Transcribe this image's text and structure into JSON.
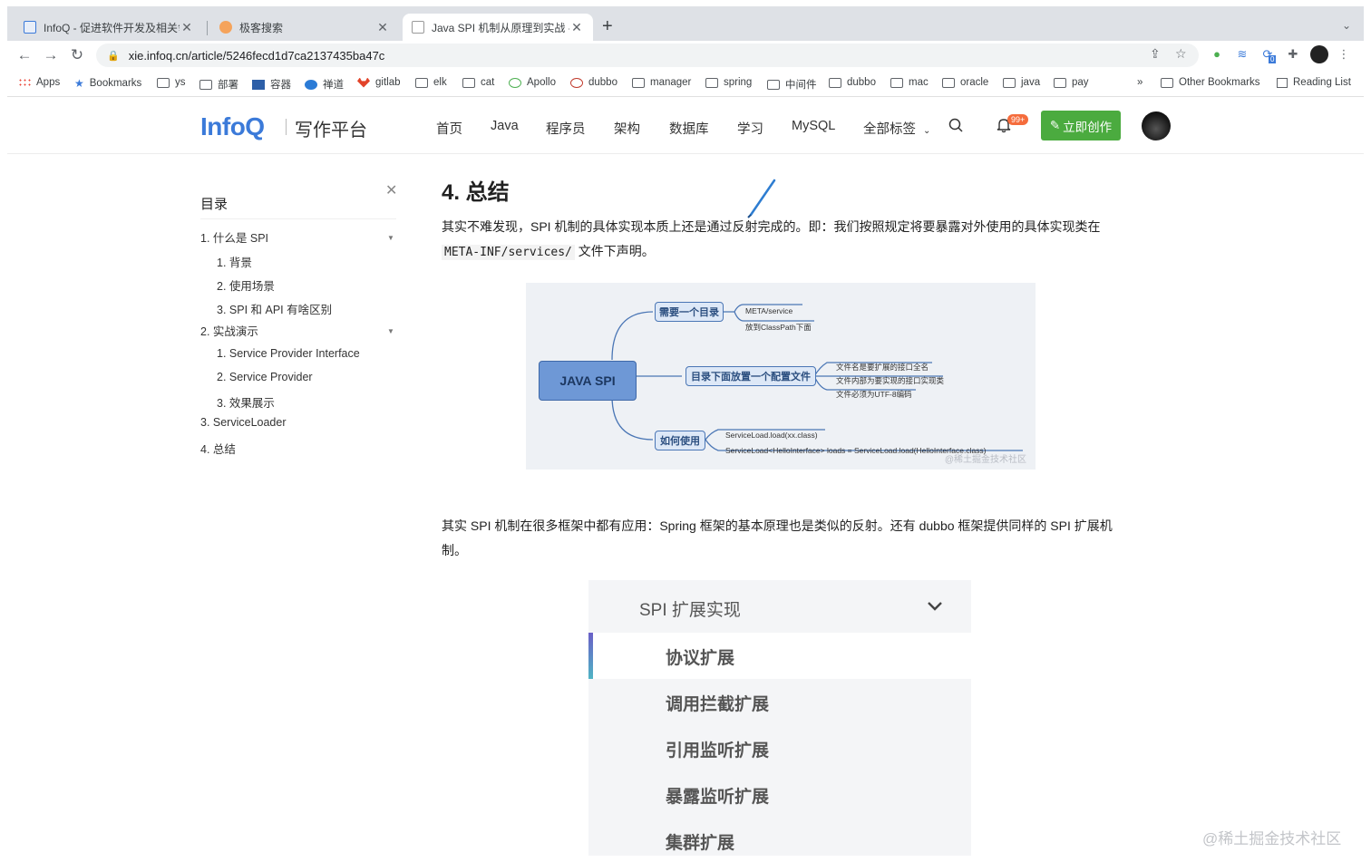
{
  "browser": {
    "tabs": [
      {
        "title": "InfoQ - 促进软件开发及相关领域",
        "active": false
      },
      {
        "title": "极客搜索",
        "active": false
      },
      {
        "title": "Java SPI 机制从原理到实战 - InfoQ",
        "active": true
      }
    ],
    "url": "xie.infoq.cn/article/5246fecd1d7ca2137435ba47c",
    "bookmarks": [
      "Apps",
      "Bookmarks",
      "ys",
      "部署",
      "容器",
      "禅道",
      "gitlab",
      "elk",
      "cat",
      "Apollo",
      "dubbo",
      "manager",
      "spring",
      "中间件",
      "dubbo",
      "mac",
      "oracle",
      "java",
      "pay"
    ],
    "bookmarks_more": "»",
    "other_bookmarks": "Other Bookmarks",
    "reading_list": "Reading List",
    "ext_badge": "0"
  },
  "site": {
    "logo": "InfoQ",
    "logo_sub": "写作平台",
    "nav": [
      "首页",
      "Java",
      "程序员",
      "架构",
      "数据库",
      "学习",
      "MySQL",
      "全部标签"
    ],
    "notif_badge": "99+",
    "create_button": "立即创作"
  },
  "toc": {
    "title": "目录",
    "items": [
      {
        "label": "1. 什么是 SPI",
        "level": 0
      },
      {
        "label": "1. 背景",
        "level": 1
      },
      {
        "label": "2. 使用场景",
        "level": 1
      },
      {
        "label": "3. SPI 和 API 有啥区别",
        "level": 1
      },
      {
        "label": "2. 实战演示",
        "level": 0
      },
      {
        "label": "1. Service Provider Interface",
        "level": 1
      },
      {
        "label": "2. Service Provider",
        "level": 1
      },
      {
        "label": "3. 效果展示",
        "level": 1
      },
      {
        "label": "3. ServiceLoader",
        "level": 0
      },
      {
        "label": "4. 总结",
        "level": 0
      }
    ]
  },
  "article": {
    "heading": "4. 总结",
    "para1_a": "其实不难发现，SPI 机制的具体实现本质上还是通过反射完成的。即：我们按照规定将要暴露对外使用的具体实现类在",
    "para1_code": "META-INF/services/",
    "para1_b": " 文件下声明。",
    "para2": "其实 SPI 机制在很多框架中都有应用：Spring 框架的基本原理也是类似的反射。还有 dubbo 框架提供同样的 SPI 扩展机制。"
  },
  "mindmap": {
    "root": "JAVA SPI",
    "branches": [
      {
        "label": "需要一个目录",
        "leaves": [
          "META/service",
          "放到ClassPath下面"
        ]
      },
      {
        "label": "目录下面放置一个配置文件",
        "leaves": [
          "文件名是要扩展的接口全名",
          "文件内部为要实现的接口实现类",
          "文件必须为UTF-8编码"
        ]
      },
      {
        "label": "如何使用",
        "leaves": [
          "ServiceLoad.load(xx.class)",
          "ServiceLoad<HelloInterface> loads = ServiceLoad.load(HelloInterface.class)"
        ]
      }
    ],
    "watermark": "@稀土掘金技术社区"
  },
  "spi_menu": {
    "title": "SPI 扩展实现",
    "items": [
      "协议扩展",
      "调用拦截扩展",
      "引用监听扩展",
      "暴露监听扩展",
      "集群扩展"
    ],
    "active_index": 0
  },
  "page_watermark": "@稀土掘金技术社区",
  "colors": {
    "brand": "#3b7ad9",
    "create": "#4bab3f",
    "badge": "#f56c3c"
  }
}
